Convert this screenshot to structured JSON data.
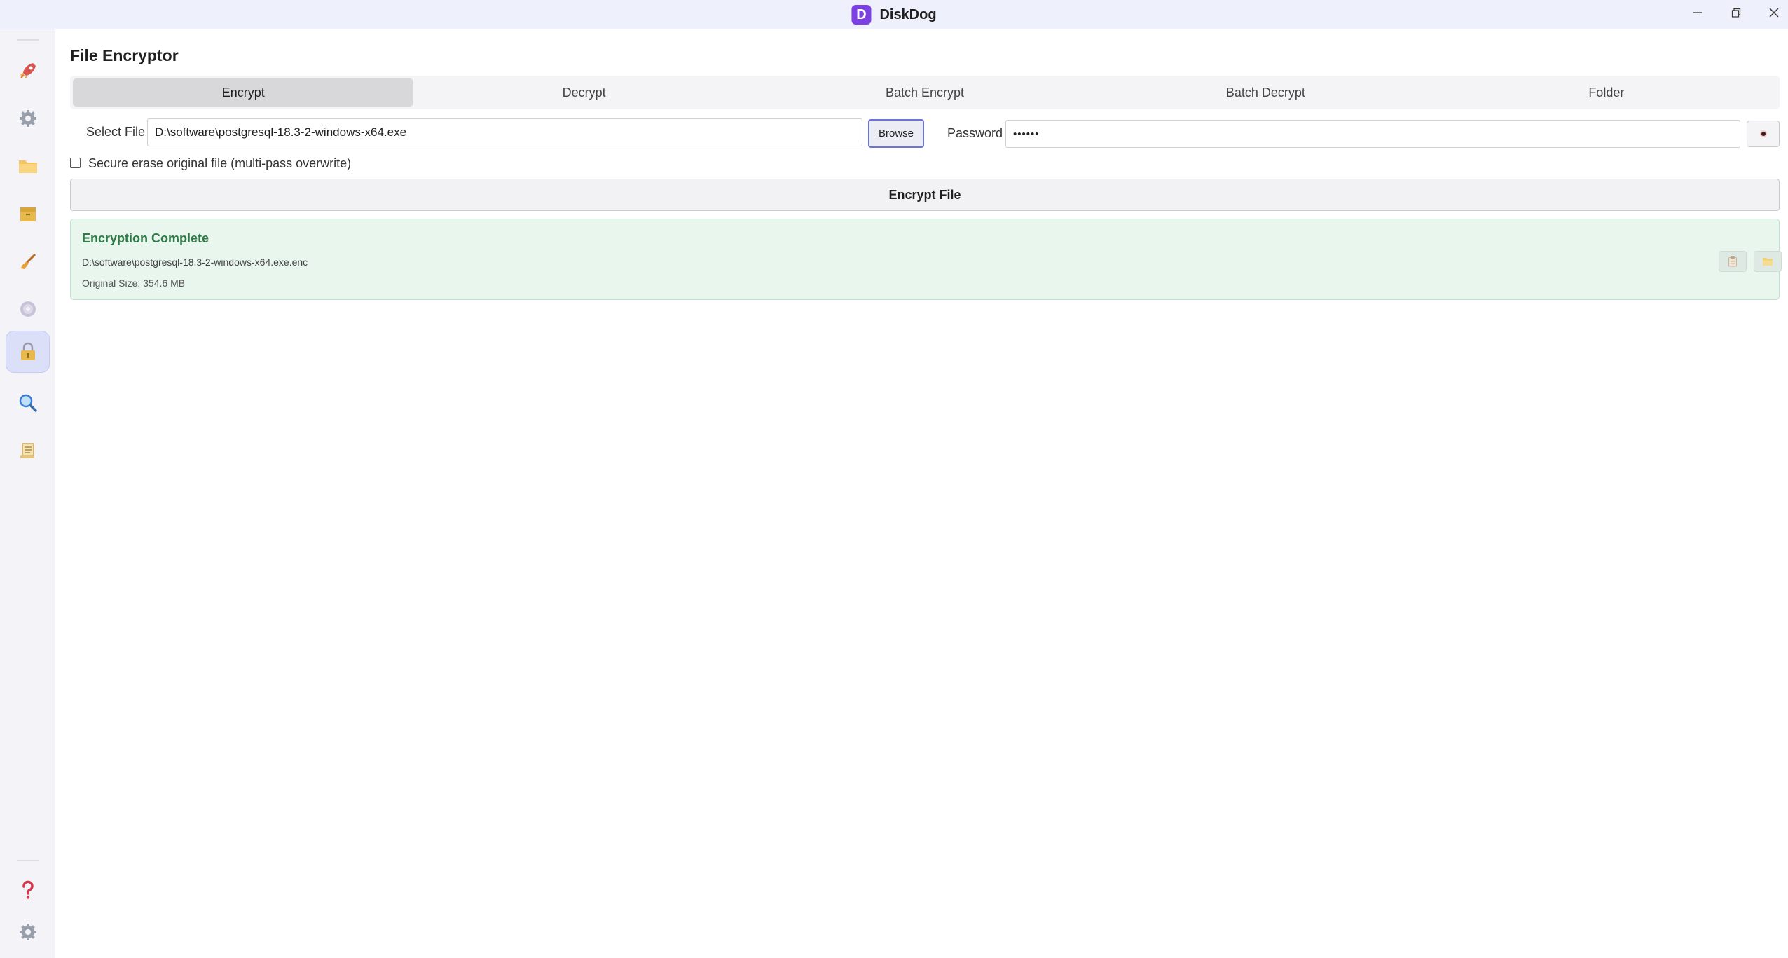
{
  "titlebar": {
    "logo_letter": "D",
    "app_name": "DiskDog",
    "controls": [
      "minimize-icon",
      "restore-icon",
      "close-icon"
    ]
  },
  "sidebar": {
    "items": [
      {
        "name": "rocket-icon"
      },
      {
        "name": "gear-icon"
      },
      {
        "name": "folder-icon"
      },
      {
        "name": "file-cabinet-icon"
      },
      {
        "name": "brush-icon"
      },
      {
        "name": "disc-icon"
      },
      {
        "name": "lock-icon",
        "active": true
      },
      {
        "name": "magnifier-icon"
      },
      {
        "name": "scroll-icon"
      }
    ],
    "bottom_items": [
      {
        "name": "help-icon"
      },
      {
        "name": "settings-icon"
      }
    ]
  },
  "main": {
    "title": "File Encryptor",
    "tabs": [
      {
        "label": "Encrypt",
        "active": true
      },
      {
        "label": "Decrypt"
      },
      {
        "label": "Batch Encrypt"
      },
      {
        "label": "Batch Decrypt"
      },
      {
        "label": "Folder"
      }
    ],
    "select_file": {
      "label": "Select File",
      "value": "D:\\software\\postgresql-18.3-2-windows-x64.exe",
      "browse_label": "Browse"
    },
    "password": {
      "label": "Password",
      "value": "••••••"
    },
    "secure_erase": {
      "label": "Secure erase original file (multi-pass overwrite)",
      "checked": false
    },
    "encrypt_button": "Encrypt File",
    "result": {
      "title": "Encryption Complete",
      "path": "D:\\software\\postgresql-18.3-2-windows-x64.exe.enc",
      "size": "Original Size: 354.6 MB"
    }
  },
  "colors": {
    "accent": "#7b3fe4",
    "success_bg": "#e9f6ee",
    "success_text": "#2f7a47",
    "sidebar_active": "#dcdff8"
  }
}
